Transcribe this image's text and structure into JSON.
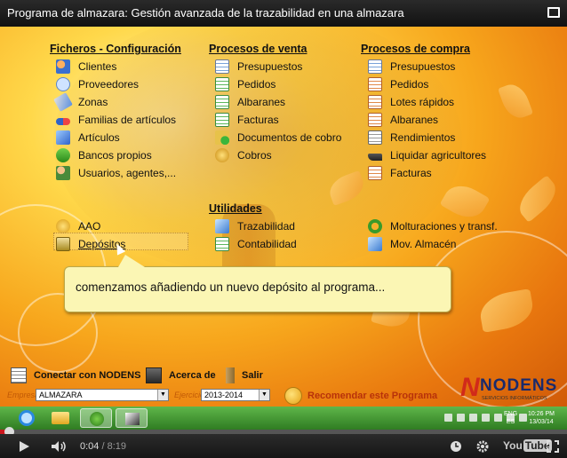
{
  "video": {
    "title": "Programa de almazara: Gestión avanzada de la trazabilidad en una almazara",
    "time_current": "0:04",
    "time_separator": " / ",
    "time_total": "8:19",
    "progress_fraction": 0.008,
    "logo_text": "You",
    "logo_tube": "Tube"
  },
  "menu": {
    "col1": {
      "heading": "Ficheros - Configuración",
      "items": [
        "Clientes",
        "Proveedores",
        "Zonas",
        "Familias de artículos",
        "Artículos",
        "Bancos propios",
        "Usuarios, agentes,..."
      ],
      "extra": [
        "AAO",
        "Depósitos"
      ]
    },
    "col2": {
      "heading": "Procesos de venta",
      "items": [
        "Presupuestos",
        "Pedidos",
        "Albaranes",
        "Facturas",
        "Documentos de cobro",
        "Cobros"
      ]
    },
    "col2b": {
      "heading": "Utilidades",
      "items": [
        "Trazabilidad",
        "Contabilidad"
      ]
    },
    "col3": {
      "heading": "Procesos de compra",
      "items": [
        "Presupuestos",
        "Pedidos",
        "Lotes rápidos",
        "Albaranes",
        "Rendimientos",
        "Liquidar agricultores",
        "Facturas"
      ],
      "extra": [
        "Molturaciones y transf.",
        "Mov. Almacén"
      ]
    }
  },
  "tooltip": {
    "text": "comenzamos añadiendo un nuevo depósito al programa..."
  },
  "bottom": {
    "connect_label": "Conectar con NODENS",
    "about_label": "Acerca de",
    "exit_label": "Salir",
    "company_label": "Empresa",
    "company_value": "ALMAZARA",
    "year_label": "Ejercicio",
    "year_value": "2013-2014",
    "recommend_label": "Recomendar este Programa",
    "brand_letter": "N",
    "brand_name": "NODENS",
    "brand_sub": "SERVICIOS INFORMÁTICOS"
  },
  "taskbar": {
    "lang_line1": "ENG",
    "lang_line2": "ES",
    "clock_time": "10:26 PM",
    "clock_date": "13/03/14"
  },
  "colors": {
    "tooltip_bg": "#fbf6b4",
    "taskbar": "#3f9a31",
    "brand_red": "#d12a1a",
    "brand_blue": "#1a2a6c"
  }
}
